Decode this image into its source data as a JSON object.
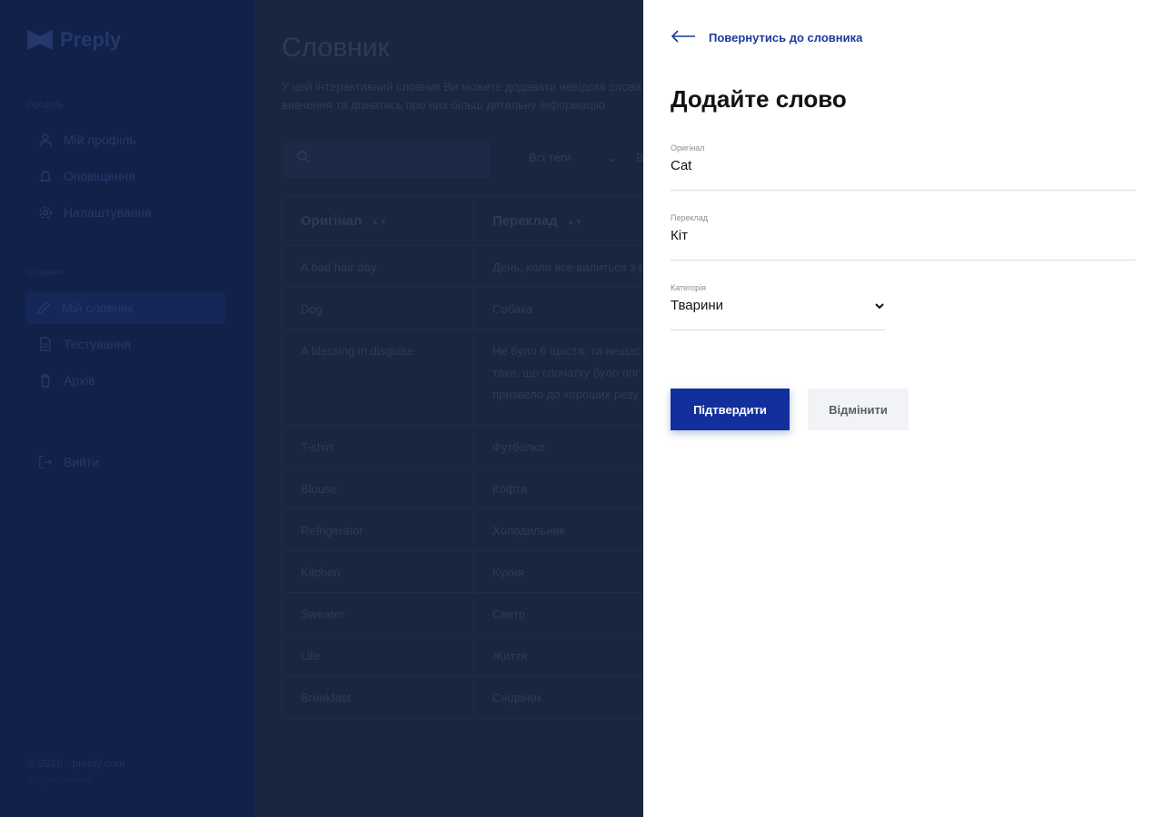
{
  "sidebar": {
    "logo_text": "Preply",
    "profile_section": "Профіль",
    "profile_items": [
      {
        "label": "Мій профіль",
        "icon": "user-icon"
      },
      {
        "label": "Оповіщення",
        "icon": "bell-icon"
      },
      {
        "label": "Налаштування",
        "icon": "gear-icon"
      }
    ],
    "dictionary_section": "Словник",
    "dictionary_items": [
      {
        "label": "Мій словник",
        "icon": "pencil-icon",
        "active": true
      },
      {
        "label": "Тестування",
        "icon": "document-icon"
      },
      {
        "label": "Архів",
        "icon": "trash-icon"
      }
    ],
    "logout_label": "Вийти",
    "copyright": "© 2018 - preply.com",
    "rights": "All rights reserved"
  },
  "main": {
    "title": "Словник",
    "description_line1": "У цей інтерактивний словник Ви можете додавати невідомі слова",
    "description_line2": "вивчення та дізнатись про них більш детальну інформацію",
    "tags_filter": "Всі теги",
    "extra_filter": "В",
    "table": {
      "headers": [
        "Оригінал",
        "Переклад"
      ],
      "rows": [
        [
          "A bad hair day",
          "День, коли все валиться з р"
        ],
        [
          "Dog",
          "Собака"
        ],
        [
          "A blessing in disguise",
          "Не було б щастя, та нещаст"
        ],
        [
          "T-shirt",
          "Футболка"
        ],
        [
          "Blouse",
          "Кофта"
        ],
        [
          "Refrigerator",
          "Холодильник"
        ],
        [
          "Kitchen",
          "Кухня"
        ],
        [
          "Sweater",
          "Светр"
        ],
        [
          "Life",
          "Життя"
        ],
        [
          "Breakfast",
          "Сніданок"
        ]
      ],
      "row3_extra_line2": "таке, що спочатку було пог",
      "row3_extra_line3": "призвело до хороших резу"
    }
  },
  "drawer": {
    "back_label": "Повернутись до словника",
    "title": "Додайте слово",
    "original_label": "Оригінал",
    "original_value": "Cat",
    "translation_label": "Переклад",
    "translation_value": "Кіт",
    "category_label": "Категорія",
    "category_value": "Тварини",
    "confirm_label": "Підтвердити",
    "cancel_label": "Відмінити"
  },
  "colors": {
    "accent": "#12309c",
    "overlay": "#0d1e3f",
    "text_dark": "#121212"
  }
}
